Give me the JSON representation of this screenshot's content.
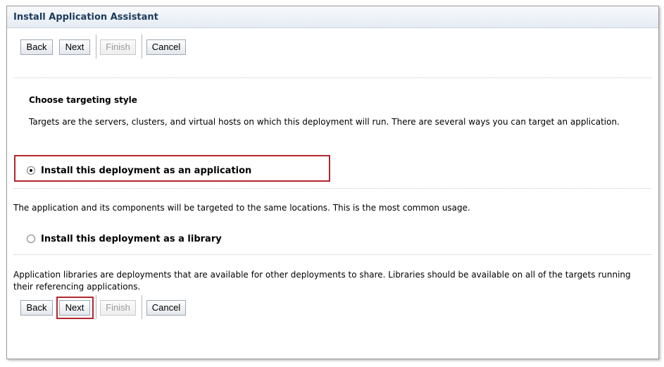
{
  "title": "Install Application Assistant",
  "buttons": {
    "back": "Back",
    "next": "Next",
    "finish": "Finish",
    "cancel": "Cancel"
  },
  "section": {
    "heading": "Choose targeting style",
    "description": "Targets are the servers, clusters, and virtual hosts on which this deployment will run. There are several ways you can target an application."
  },
  "options": [
    {
      "label": "Install this deployment as an application",
      "checked": true,
      "description": "The application and its components will be targeted to the same locations. This is the most common usage."
    },
    {
      "label": "Install this deployment as a library",
      "checked": false,
      "description": "Application libraries are deployments that are available for other deployments to share. Libraries should be available on all of the targets running their referencing applications."
    }
  ],
  "colors": {
    "highlight": "#b1282e",
    "title_text": "#1c3a5c"
  }
}
